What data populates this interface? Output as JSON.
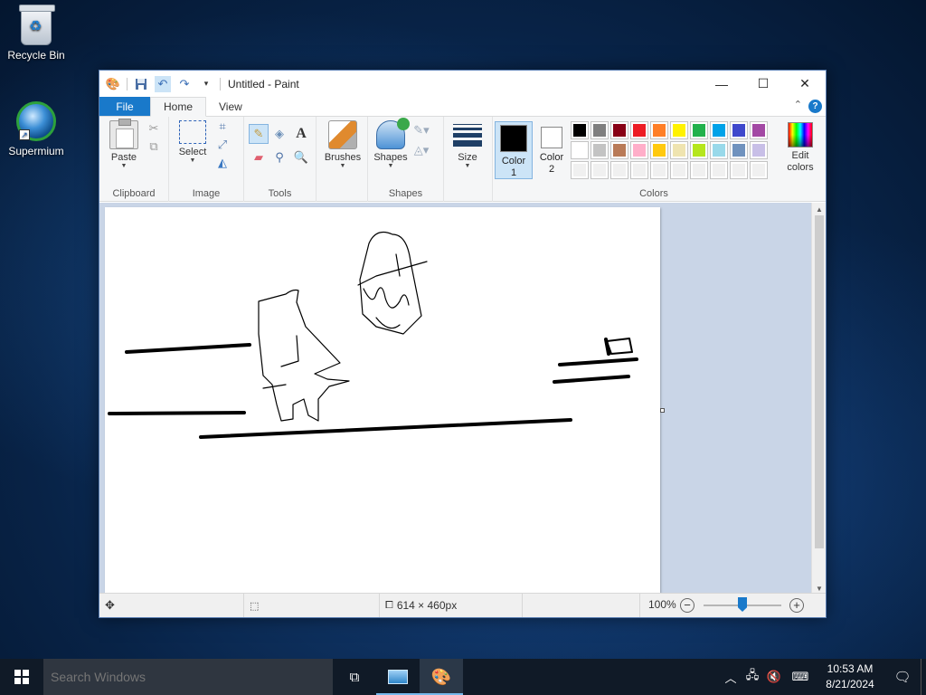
{
  "desktop": {
    "icons": [
      {
        "label": "Recycle Bin"
      },
      {
        "label": "Supermium"
      }
    ]
  },
  "window": {
    "title": "Untitled - Paint",
    "quick_access_icons": [
      "paint-app-icon",
      "save-icon",
      "undo-icon",
      "redo-icon",
      "customize-dropdown-icon"
    ],
    "controls": {
      "minimize": "—",
      "maximize": "☐",
      "close": "✕"
    }
  },
  "ribbon": {
    "tabs": [
      {
        "label": "File"
      },
      {
        "label": "Home"
      },
      {
        "label": "View"
      }
    ],
    "help": "?",
    "groups": {
      "clipboard": {
        "label": "Clipboard",
        "paste": "Paste"
      },
      "image": {
        "label": "Image",
        "select": "Select"
      },
      "tools": {
        "label": "Tools"
      },
      "brushes": {
        "label": "Brushes"
      },
      "shapes": {
        "label": "Shapes",
        "shapes_btn": "Shapes"
      },
      "size": {
        "label": "Size"
      },
      "colors": {
        "label": "Colors",
        "color1_line1": "Color",
        "color1_line2": "1",
        "color2_line1": "Color",
        "color2_line2": "2",
        "color1_value": "#000000",
        "color2_value": "#ffffff",
        "edit_line1": "Edit",
        "edit_line2": "colors",
        "palette": [
          "#000000",
          "#7f7f7f",
          "#880015",
          "#ed1c24",
          "#ff7f27",
          "#fff200",
          "#22b14c",
          "#00a2e8",
          "#3f48cc",
          "#a349a4",
          "#ffffff",
          "#c3c3c3",
          "#b97a57",
          "#ffaec9",
          "#ffc90e",
          "#efe4b0",
          "#b5e61d",
          "#99d9ea",
          "#7092be",
          "#c8bfe7",
          "",
          "",
          "",
          "",
          "",
          "",
          "",
          "",
          "",
          ""
        ]
      }
    }
  },
  "status": {
    "dimensions": "614 × 460px",
    "zoom": "100%"
  },
  "taskbar": {
    "search_placeholder": "Search Windows",
    "time": "10:53 AM",
    "date": "8/21/2024"
  },
  "colors": {
    "accent": "#1979ca",
    "taskbar": "#101a27"
  }
}
